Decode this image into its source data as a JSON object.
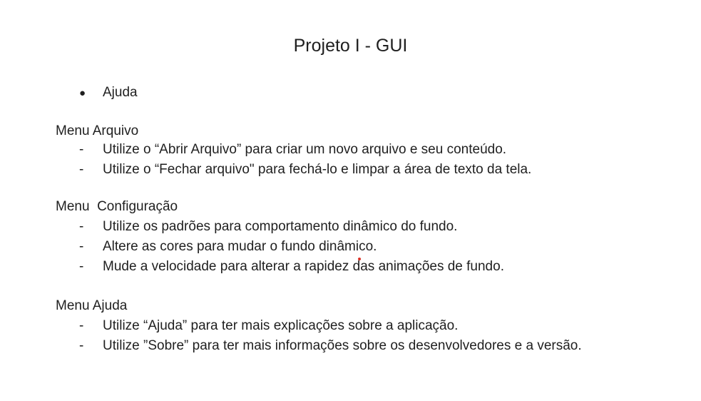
{
  "document": {
    "title": "Projeto I - GUI",
    "bullet": {
      "symbol": "●",
      "label": "Ajuda"
    },
    "sections": [
      {
        "heading": "Menu Arquivo",
        "items": [
          "Utilize o “Abrir Arquivo” para criar um novo arquivo e seu conteúdo.",
          "Utilize o “Fechar arquivo\" para fechá-lo e limpar a área de texto da tela."
        ]
      },
      {
        "heading": "Menu  Configuração",
        "items": [
          "Utilize os padrões para comportamento dinâmico do fundo.",
          "Altere as cores para mudar o fundo dinâmico.",
          "Mude a velocidade para alterar a rapidez das animações de fundo."
        ]
      },
      {
        "heading": "Menu Ajuda",
        "items": [
          "Utilize “Ajuda” para ter mais explicações sobre a aplicação.",
          "Utilize ”Sobre” para ter mais informações sobre os desenvolvedores e a versão."
        ]
      }
    ],
    "dash": "-"
  },
  "colors": {
    "text": "#1f1f1f",
    "background": "#ffffff",
    "cursor_marker": "#d93025"
  }
}
